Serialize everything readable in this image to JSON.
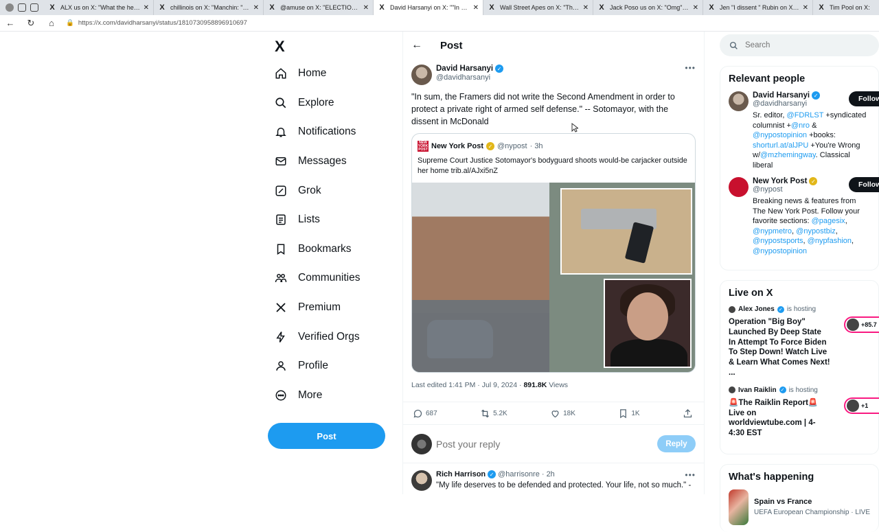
{
  "browser": {
    "tabs": [
      {
        "title": "ALX us on X: \"What the hell... htt",
        "active": false
      },
      {
        "title": "chillinois on X: \"Manchin: \"If you",
        "active": false
      },
      {
        "title": "@amuse on X: \"ELECTION INTERF",
        "active": false
      },
      {
        "title": "David Harsanyi on X: \"\"In sum, th",
        "active": true
      },
      {
        "title": "Wall Street Apes on X: \"Things A",
        "active": false
      },
      {
        "title": "Jack Poso us on X: \"Omg\" / X",
        "active": false
      },
      {
        "title": "Jen \"I dissent \" Rubin on X: \"HOU",
        "active": false
      },
      {
        "title": "Tim Pool on X:",
        "active": false
      }
    ],
    "url": "https://x.com/davidharsanyi/status/1810730958896910697"
  },
  "nav": {
    "logo": "X",
    "items": [
      {
        "label": "Home",
        "icon": "home-icon"
      },
      {
        "label": "Explore",
        "icon": "search-icon"
      },
      {
        "label": "Notifications",
        "icon": "bell-icon"
      },
      {
        "label": "Messages",
        "icon": "envelope-icon"
      },
      {
        "label": "Grok",
        "icon": "grok-icon"
      },
      {
        "label": "Lists",
        "icon": "list-icon"
      },
      {
        "label": "Bookmarks",
        "icon": "bookmark-icon"
      },
      {
        "label": "Communities",
        "icon": "people-icon"
      },
      {
        "label": "Premium",
        "icon": "x-icon"
      },
      {
        "label": "Verified Orgs",
        "icon": "bolt-icon"
      },
      {
        "label": "Profile",
        "icon": "person-icon"
      },
      {
        "label": "More",
        "icon": "more-circle-icon"
      }
    ],
    "post_button": "Post"
  },
  "main": {
    "header_title": "Post",
    "author": {
      "name": "David Harsanyi",
      "handle": "@davidharsanyi"
    },
    "text": "\"In sum, the Framers did not write the Second Amendment in order to protect a private right of armed self defense.\" -- Sotomayor, with the dissent in McDonald",
    "quote": {
      "logo_text": "NEW YORK POST",
      "name": "New York Post",
      "handle": "@nypost",
      "time": "· 3h",
      "text": "Supreme Court Justice Sotomayor's bodyguard shoots would-be carjacker outside her home trib.al/AJxi5nZ"
    },
    "meta": {
      "edited": "Last edited 1:41 PM · Jul 9, 2024 · ",
      "views_count": "891.8K",
      "views_label": " Views"
    },
    "actions": {
      "replies": "687",
      "reposts": "5.2K",
      "likes": "18K",
      "bookmarks": "1K"
    },
    "reply_placeholder": "Post your reply",
    "reply_button": "Reply",
    "first_reply": {
      "name": "Rich Harrison",
      "handle": "@harrisonre",
      "time": "· 2h",
      "text": "\"My life deserves to be defended and protected.  Your life, not so much.\" -"
    }
  },
  "right": {
    "search_placeholder": "Search",
    "relevant_title": "Relevant people",
    "people": [
      {
        "name": "David Harsanyi",
        "handle": "@davidharsanyi",
        "follow": "Follow",
        "bio_parts": [
          {
            "t": "Sr. editor, ",
            "link": false
          },
          {
            "t": "@FDRLST",
            "link": true
          },
          {
            "t": " +syndicated columnist +",
            "link": false
          },
          {
            "t": "@nro",
            "link": true
          },
          {
            "t": " & ",
            "link": false
          },
          {
            "t": "@nypostopinion",
            "link": true
          },
          {
            "t": " +books: ",
            "link": false
          },
          {
            "t": "shorturl.at/alJPU",
            "link": true
          },
          {
            "t": " +You're Wrong w/",
            "link": false
          },
          {
            "t": "@mzhemingway",
            "link": true
          },
          {
            "t": ". Classical liberal",
            "link": false
          }
        ]
      },
      {
        "name": "New York Post",
        "handle": "@nypost",
        "follow": "Follow",
        "bio_parts": [
          {
            "t": "Breaking news & features from The New York Post. Follow your favorite sections: ",
            "link": false
          },
          {
            "t": "@pagesix",
            "link": true
          },
          {
            "t": ", ",
            "link": false
          },
          {
            "t": "@nypmetro",
            "link": true
          },
          {
            "t": ", ",
            "link": false
          },
          {
            "t": "@nypostbiz",
            "link": true
          },
          {
            "t": ", ",
            "link": false
          },
          {
            "t": "@nypostsports",
            "link": true
          },
          {
            "t": ", ",
            "link": false
          },
          {
            "t": "@nypfashion",
            "link": true
          },
          {
            "t": ", ",
            "link": false
          },
          {
            "t": "@nypostopinion",
            "link": true
          }
        ]
      }
    ],
    "live_title": "Live on X",
    "live": [
      {
        "host": "Alex Jones",
        "hosting": "is hosting",
        "title": "Operation \"Big Boy\" Launched By Deep State In Attempt To Force Biden To Step Down! Watch Live & Learn What Comes Next! ...",
        "count": "+85.7"
      },
      {
        "host": "Ivan Raiklin",
        "hosting": "is hosting",
        "title": "🚨The Raiklin Report🚨 Live on worldviewtube.com | 4-4:30 EST",
        "count": "+1"
      }
    ],
    "happening_title": "What's happening",
    "trend": {
      "title": "Spain vs France",
      "sub": "UEFA European Championship · LIVE"
    }
  },
  "colors": {
    "accent": "#1d9bf0",
    "text": "#0f1419",
    "muted": "#536471",
    "live": "#f91880"
  }
}
